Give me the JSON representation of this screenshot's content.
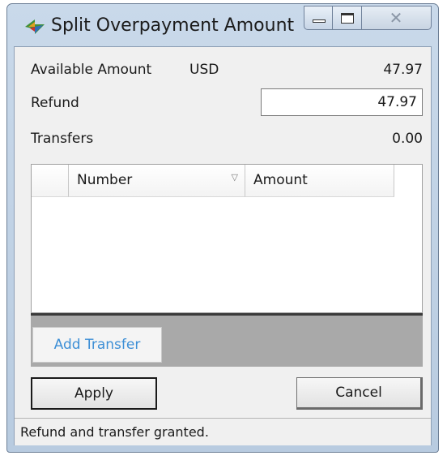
{
  "window": {
    "title": "Split Overpayment Amount",
    "close_glyph": "✕",
    "icons": {
      "app": "app-logo-icon",
      "minimize": "minimize-icon",
      "maximize": "maximize-icon",
      "close": "close-icon"
    }
  },
  "form": {
    "available_label": "Available Amount",
    "currency": "USD",
    "available_value": "47.97",
    "refund_label": "Refund",
    "refund_value": "47.97",
    "transfers_label": "Transfers",
    "transfers_value": "0.00"
  },
  "grid": {
    "columns": [
      "",
      "Number",
      "Amount"
    ],
    "sort_glyph": "▽",
    "rows": []
  },
  "buttons": {
    "add_transfer": "Add Transfer",
    "apply": "Apply",
    "cancel": "Cancel"
  },
  "status": {
    "message": "Refund and transfer granted."
  },
  "colors": {
    "link_blue": "#3d8fd6",
    "titlebar": "#c9d9ea"
  }
}
